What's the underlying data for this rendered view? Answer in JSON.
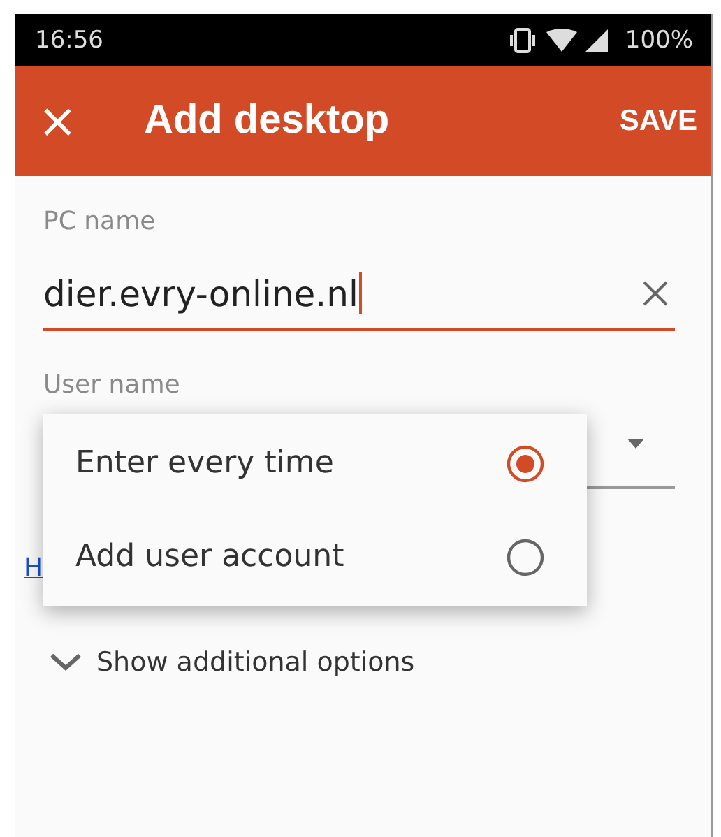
{
  "status_bar": {
    "time": "16:56",
    "battery": "100%"
  },
  "app_bar": {
    "close": "×",
    "title": "Add desktop",
    "action": "SAVE"
  },
  "pc_name": {
    "label": "PC name",
    "value": "dier.evry-online.nl",
    "focused": true
  },
  "user_name": {
    "label": "User name"
  },
  "link": {
    "text": "H"
  },
  "menu": {
    "items": [
      {
        "label": "Enter every time",
        "selected": true
      },
      {
        "label": "Add user account",
        "selected": false
      }
    ]
  },
  "more": {
    "label": "Show additional options",
    "expanded": false
  }
}
